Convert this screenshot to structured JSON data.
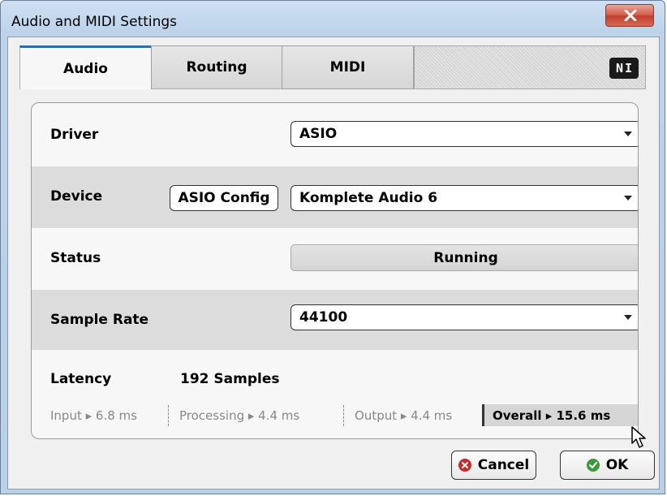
{
  "window": {
    "title": "Audio and MIDI Settings"
  },
  "tabs": [
    {
      "label": "Audio",
      "active": true
    },
    {
      "label": "Routing",
      "active": false
    },
    {
      "label": "MIDI",
      "active": false
    }
  ],
  "logo": {
    "text": "NI"
  },
  "audio": {
    "driver": {
      "label": "Driver",
      "value": "ASIO"
    },
    "device": {
      "label": "Device",
      "config_button": "ASIO Config",
      "value": "Komplete Audio 6"
    },
    "status": {
      "label": "Status",
      "value": "Running"
    },
    "sample_rate": {
      "label": "Sample Rate",
      "value": "44100"
    },
    "latency": {
      "label": "Latency",
      "value": "192 Samples",
      "input": "Input ▸ 6.8 ms",
      "processing": "Processing  ▸ 4.4 ms",
      "output": "Output ▸ 4.4 ms",
      "overall": "Overall  ▸ 15.6 ms"
    }
  },
  "buttons": {
    "cancel": "Cancel",
    "ok": "OK"
  },
  "colors": {
    "tab_accent": "#2f6ea6",
    "cancel_icon": "#cc2a2a",
    "ok_icon": "#3b9a3b",
    "close_button": "#c0402d"
  }
}
